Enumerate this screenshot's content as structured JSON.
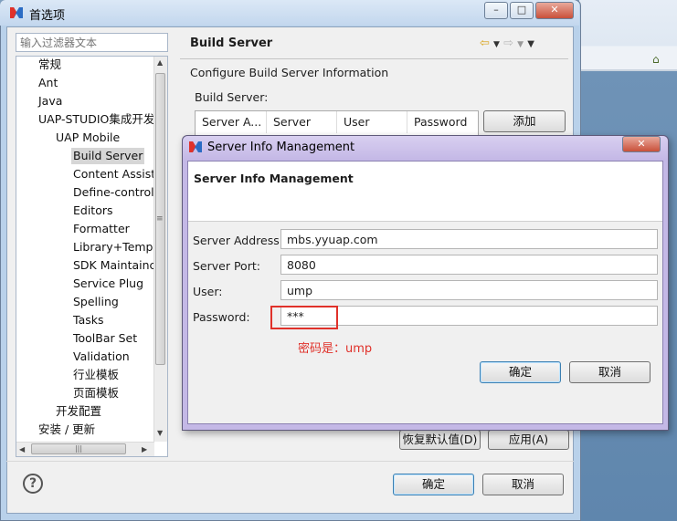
{
  "window": {
    "title": "首选项"
  },
  "filter": {
    "placeholder": "输入过滤器文本"
  },
  "tree": [
    {
      "label": "常规"
    },
    {
      "label": "Ant"
    },
    {
      "label": "Java"
    },
    {
      "label": "UAP-STUDIO集成开发"
    },
    {
      "label": "UAP Mobile"
    },
    {
      "label": "Build Server"
    },
    {
      "label": "Content Assist"
    },
    {
      "label": "Define-control"
    },
    {
      "label": "Editors"
    },
    {
      "label": "Formatter"
    },
    {
      "label": "Library+Templa"
    },
    {
      "label": "SDK Maintainc"
    },
    {
      "label": "Service Plug"
    },
    {
      "label": "Spelling"
    },
    {
      "label": "Tasks"
    },
    {
      "label": "ToolBar Set"
    },
    {
      "label": "Validation"
    },
    {
      "label": "行业模板"
    },
    {
      "label": "页面模板"
    },
    {
      "label": "开发配置"
    },
    {
      "label": "安装 / 更新"
    }
  ],
  "page": {
    "title": "Build Server",
    "description": "Configure Build Server Information",
    "table_label": "Build Server:",
    "columns": [
      "Server A...",
      "Server Port",
      "User",
      "Password"
    ],
    "add_button": "添加",
    "restore_button": "恢复默认值(D)",
    "apply_button": "应用(A)"
  },
  "footer": {
    "ok": "确定",
    "cancel": "取消"
  },
  "dialog": {
    "title": "Server Info Management",
    "heading": "Server Info Management",
    "fields": [
      {
        "label": "Server Address:",
        "value": "mbs.yyuap.com"
      },
      {
        "label": "Server Port:",
        "value": "8080"
      },
      {
        "label": "User:",
        "value": "ump"
      },
      {
        "label": "Password:",
        "value": "***"
      }
    ],
    "note": "密码是：ump",
    "ok": "确定",
    "cancel": "取消"
  },
  "colors": {
    "highlight": "#e0312a",
    "dialog_frame": "#c4b8e6",
    "window_frame": "#b9d1ea"
  }
}
